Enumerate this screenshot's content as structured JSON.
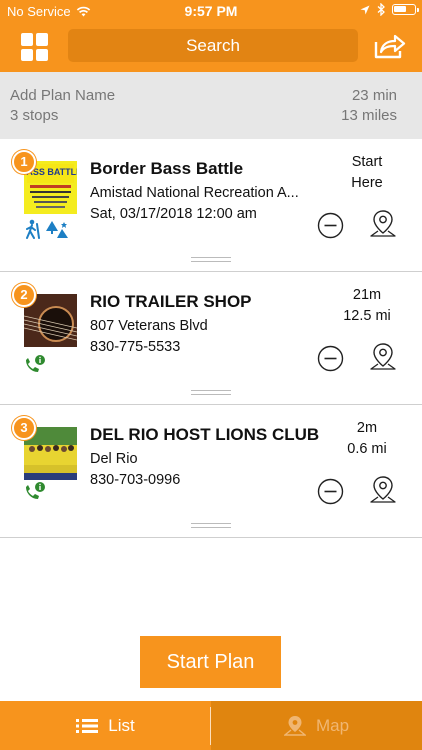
{
  "status_bar": {
    "carrier": "No Service",
    "time": "9:57 PM"
  },
  "header": {
    "search_label": "Search"
  },
  "plan": {
    "name_placeholder": "Add Plan Name",
    "stops": "3 stops",
    "duration": "23 min",
    "distance": "13 miles"
  },
  "stops": [
    {
      "number": "1",
      "title": "Border Bass Battle",
      "line1": "Amistad National Recreation A...",
      "line2": "Sat, 03/17/2018 12:00 am",
      "right_top": "Start",
      "right_bottom": "Here",
      "thumb_text": "BASS BATTLE"
    },
    {
      "number": "2",
      "title": "RIO TRAILER SHOP",
      "line1": "807 Veterans Blvd",
      "line2": "830-775-5533",
      "right_top": "21m",
      "right_bottom": "12.5 mi"
    },
    {
      "number": "3",
      "title": "DEL RIO HOST LIONS CLUB",
      "line1": "Del Rio",
      "line2": "830-703-0996",
      "right_top": "2m",
      "right_bottom": "0.6 mi"
    }
  ],
  "start_button": "Start Plan",
  "tabs": [
    {
      "label": "List",
      "icon": "list-icon",
      "active": true
    },
    {
      "label": "Map",
      "icon": "map-pin-icon",
      "active": false
    }
  ],
  "colors": {
    "accent": "#f7941d",
    "accent_dark": "#e28413",
    "plan_bg": "#e7e7e7"
  }
}
